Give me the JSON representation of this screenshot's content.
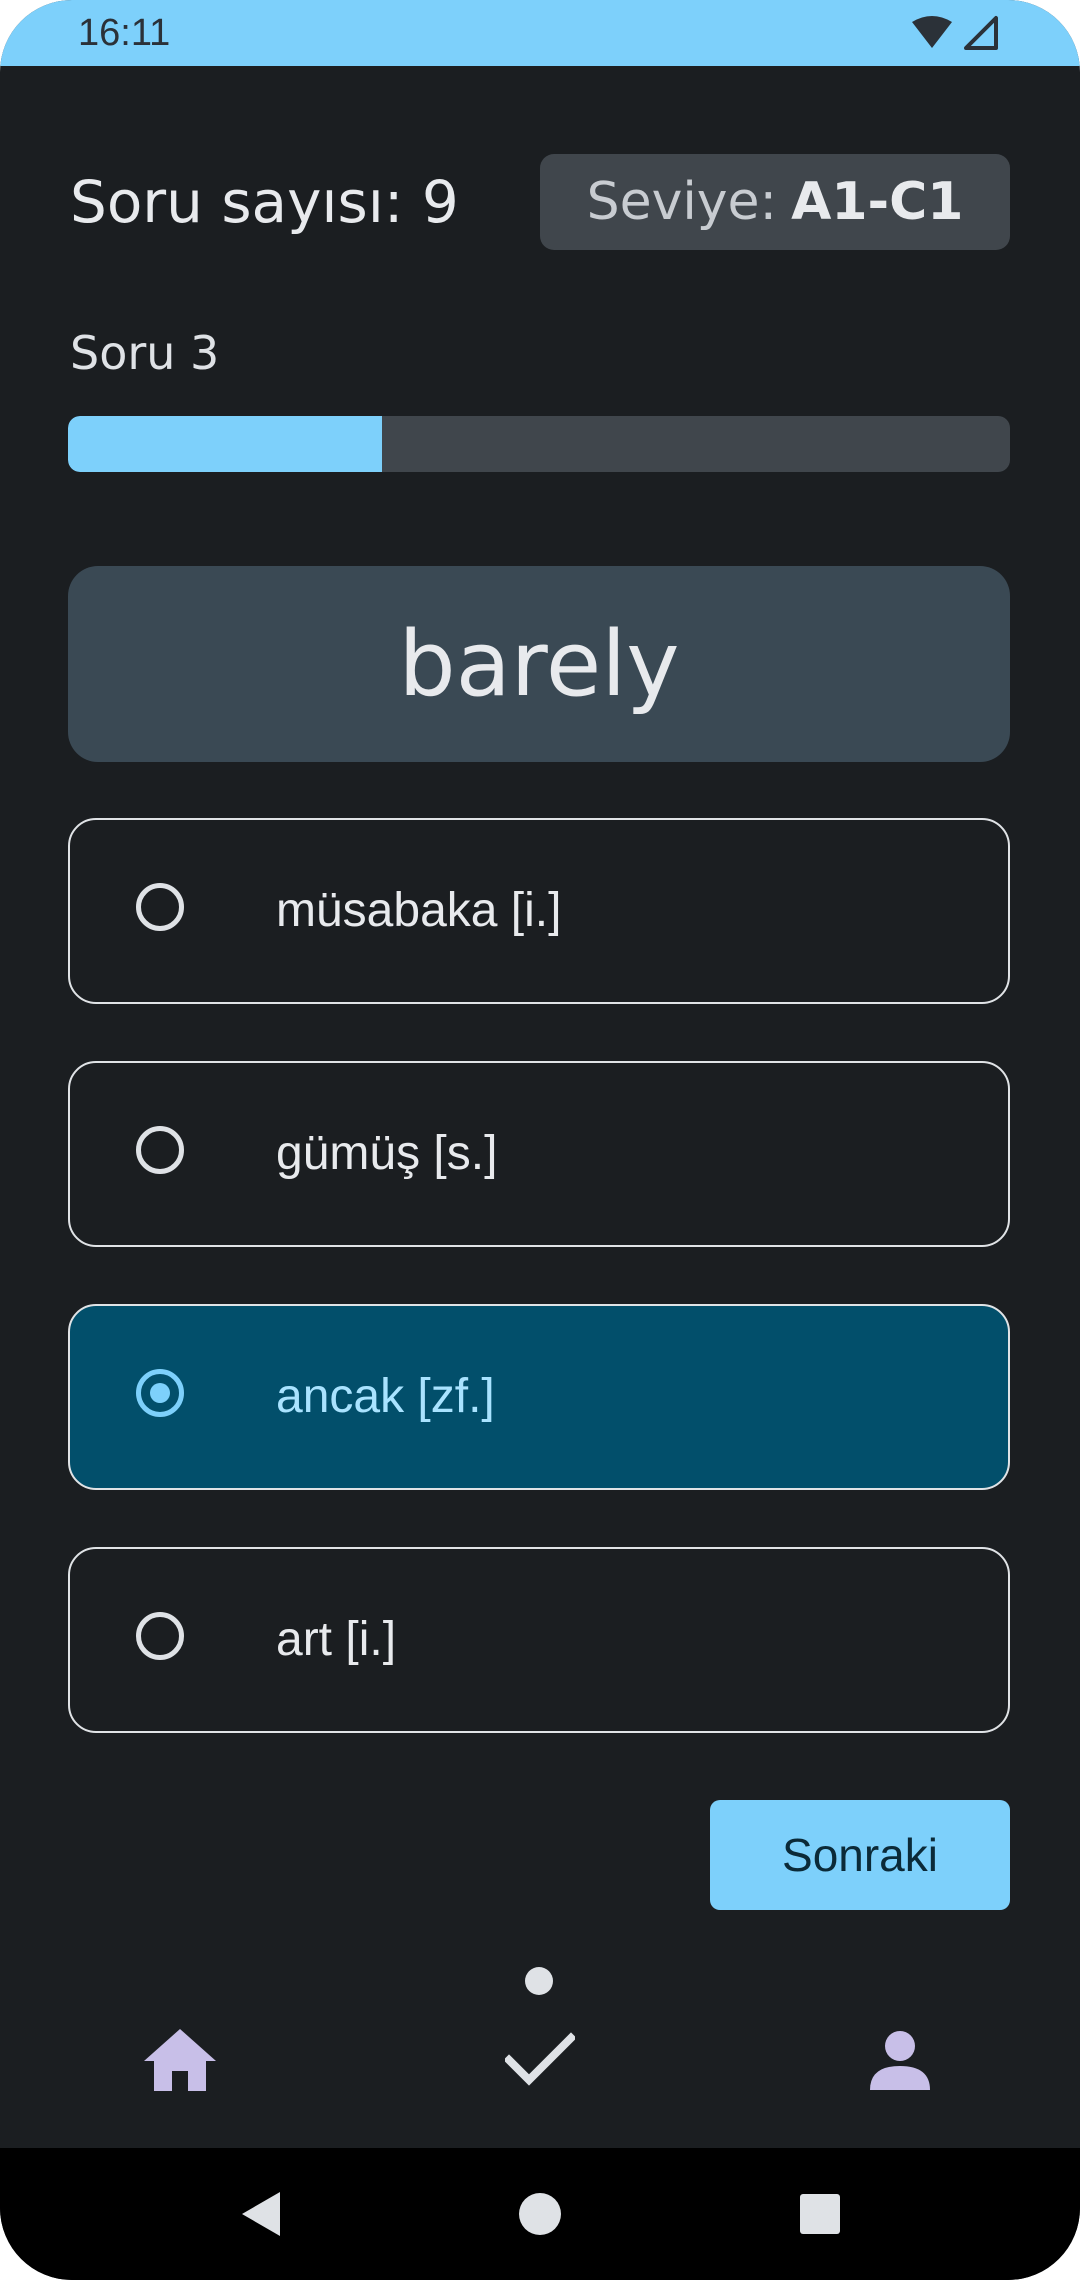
{
  "status_bar": {
    "time": "16:11"
  },
  "header": {
    "question_count": "Soru sayısı: 9",
    "level_label": "Seviye:",
    "level_value": "A1-C1"
  },
  "progress": {
    "question_label": "Soru 3",
    "fraction": 0.333
  },
  "question": {
    "word": "barely"
  },
  "options": [
    {
      "label": "müsabaka [i.]",
      "selected": false
    },
    {
      "label": "gümüş [s.]",
      "selected": false
    },
    {
      "label": "ancak [zf.]",
      "selected": true
    },
    {
      "label": "art [i.]",
      "selected": false
    }
  ],
  "actions": {
    "next_label": "Sonraki"
  },
  "bottom_nav": {
    "items": [
      {
        "icon": "home-icon",
        "active": false
      },
      {
        "icon": "check-icon",
        "active": true
      },
      {
        "icon": "person-icon",
        "active": false
      }
    ]
  },
  "colors": {
    "accent": "#7dd0fb",
    "background": "#1b1e21",
    "selected_option": "#024f6b",
    "nav_icon": "#c8bfe8"
  }
}
